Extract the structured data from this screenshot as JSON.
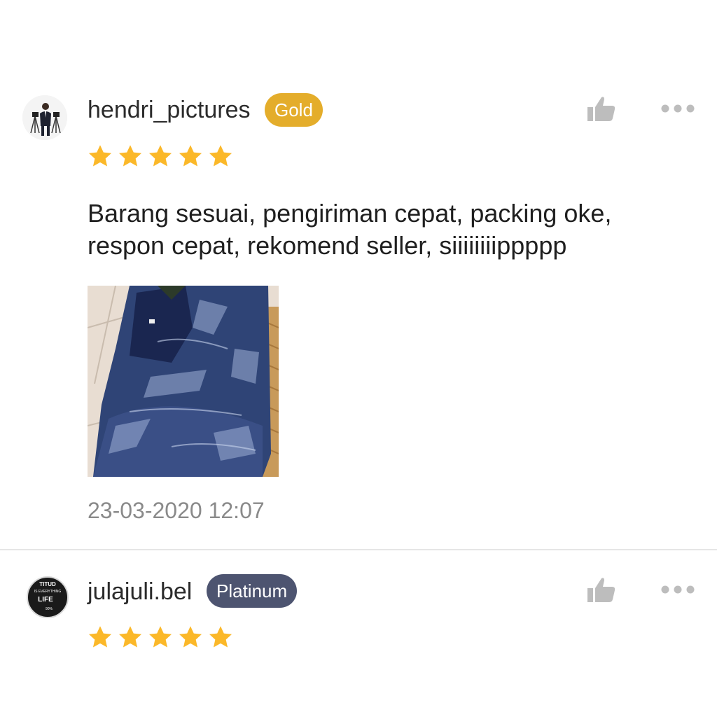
{
  "reviews": [
    {
      "username": "hendri_pictures",
      "badge": "Gold",
      "badge_color": "#e4ad2b",
      "rating": 5,
      "text": "Barang sesuai, pengiriman cepat, packing oke, respon cepat, rekomend seller, siiiiiiiippppp",
      "timestamp": "23-03-2020 12:07",
      "icons": {
        "like": "thumbs-up-icon",
        "more": "more-dots-icon"
      }
    },
    {
      "username": "julajuli.bel",
      "badge": "Platinum",
      "badge_color": "#4d5470",
      "rating": 5,
      "avatar_text": [
        "TITUD",
        "IS EVERYTHING",
        "LIFE",
        "90%"
      ],
      "icons": {
        "like": "thumbs-up-icon",
        "more": "more-dots-icon"
      }
    }
  ],
  "colors": {
    "star": "#fbb829",
    "icon_gray": "#bdbdbd",
    "divider": "#e6e6e6"
  }
}
